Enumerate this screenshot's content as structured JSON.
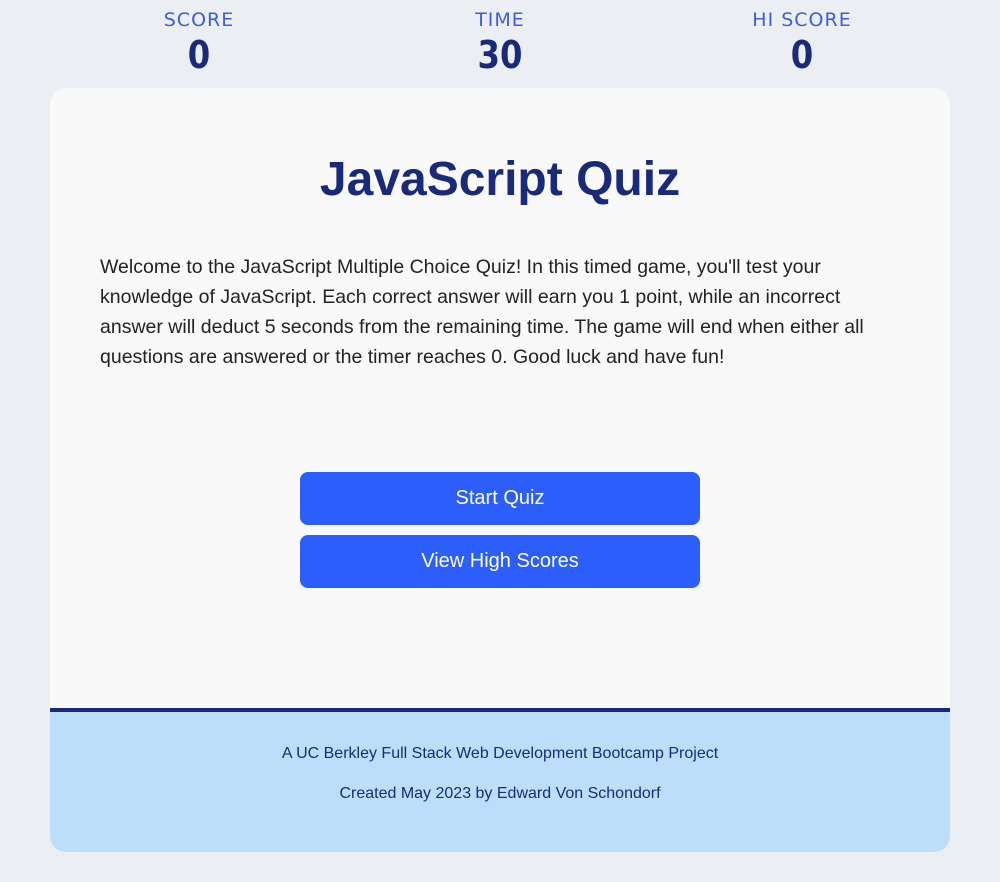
{
  "stats": {
    "score_label": "SCORE",
    "score_value": "0",
    "time_label": "TIME",
    "time_value": "30",
    "hiscore_label": "HI SCORE",
    "hiscore_value": "0"
  },
  "main": {
    "title": "JavaScript Quiz",
    "intro": "Welcome to the JavaScript Multiple Choice Quiz! In this timed game, you'll test your knowledge of JavaScript. Each correct answer will earn you 1 point, while an incorrect answer will deduct 5 seconds from the remaining time. The game will end when either all questions are answered or the timer reaches 0. Good luck and have fun!",
    "start_button": "Start Quiz",
    "high_scores_button": "View High Scores"
  },
  "footer": {
    "line1": "A UC Berkley Full Stack Web Development Bootcamp Project",
    "line2": "Created May 2023 by Edward Von Schondorf"
  },
  "colors": {
    "page_background": "#ebeff3",
    "card_background": "#f9f9fa",
    "accent_blue": "#2b5efd",
    "navy": "#1a2a7a",
    "label_blue": "#3b5fd8",
    "footer_background": "#bcdefa"
  }
}
